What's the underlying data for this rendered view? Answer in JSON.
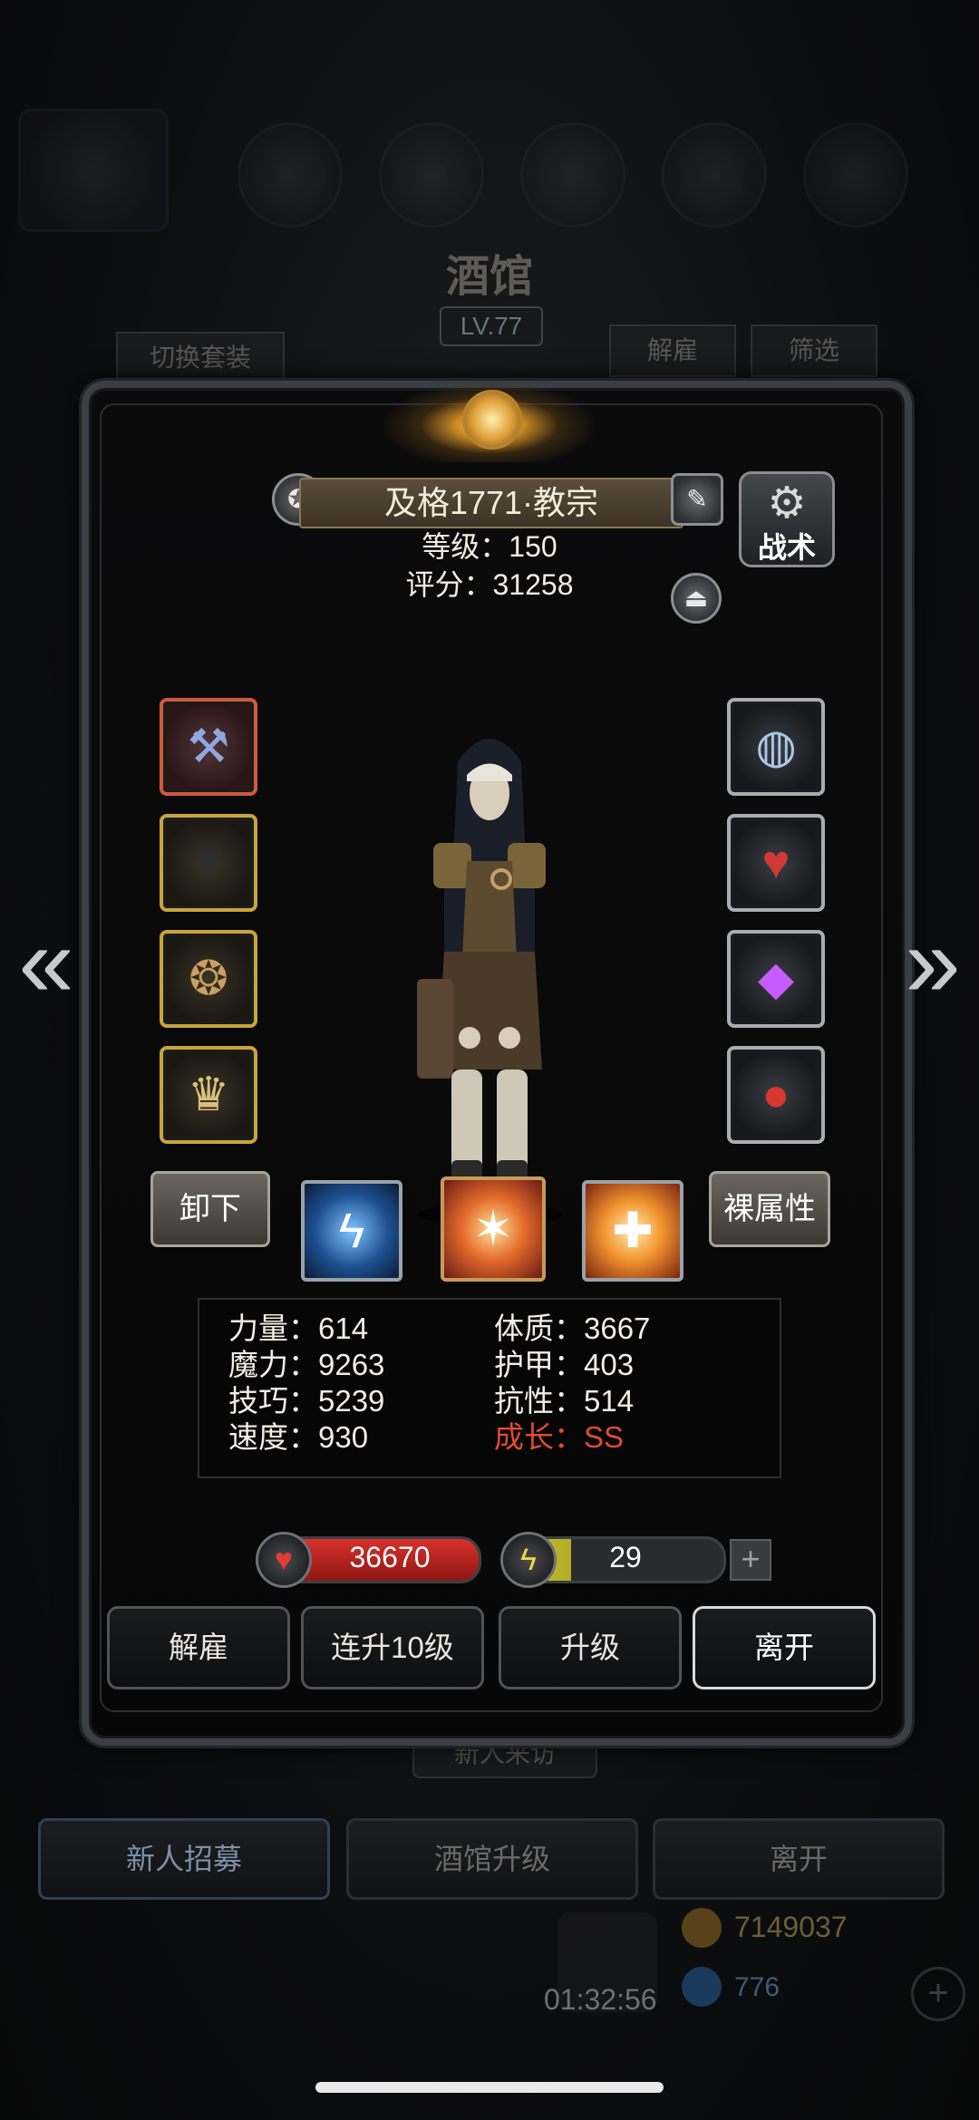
{
  "background": {
    "title": "酒馆",
    "level": "LV.77",
    "switch_outfit": "切换套装",
    "dismiss": "解雇",
    "filter": "筛选",
    "new_visitor": "新人来访",
    "bottom_buttons": [
      "新人招募",
      "酒馆升级",
      "离开"
    ],
    "gold": "7149037",
    "gems": "776",
    "timer": "01:32:56"
  },
  "hero": {
    "name": "及格1771·教宗",
    "level_line": "等级：150",
    "score_line": "评分：31258",
    "tactics_label": "战术"
  },
  "equipment": {
    "left": [
      {
        "name": "weapon-scythe-icon",
        "glyph": "⚒",
        "rarity": "red"
      },
      {
        "name": "armor-cloak-icon",
        "glyph": "▼",
        "rarity": "gold"
      },
      {
        "name": "necklace-icon",
        "glyph": "❂",
        "rarity": "gold"
      },
      {
        "name": "crown-icon",
        "glyph": "♛",
        "rarity": "gold"
      }
    ],
    "right": [
      {
        "name": "ring-icon",
        "glyph": "◍",
        "rarity": "silver"
      },
      {
        "name": "heart-gem-icon",
        "glyph": "♥",
        "rarity": "silver"
      },
      {
        "name": "purple-crystal-icon",
        "glyph": "◆",
        "rarity": "silver"
      },
      {
        "name": "red-stone-icon",
        "glyph": "●",
        "rarity": "silver"
      }
    ]
  },
  "skills": {
    "unequip": "卸下",
    "base_attributes": "裸属性"
  },
  "stats": {
    "strength": "力量：614",
    "constitution": "体质：3667",
    "magic": "魔力：9263",
    "armor": "护甲：403",
    "skill": "技巧：5239",
    "resistance": "抗性：514",
    "speed": "速度：930",
    "growth": "成长：SS"
  },
  "bars": {
    "hp": "36670",
    "energy": "29",
    "energy_fraction": 0.3
  },
  "actions": [
    "解雇",
    "连升10级",
    "升级",
    "离开"
  ],
  "colors": {
    "growth_red": "#e24a30",
    "hp_red": "#d8312c",
    "energy_yellow": "#c8c136"
  }
}
